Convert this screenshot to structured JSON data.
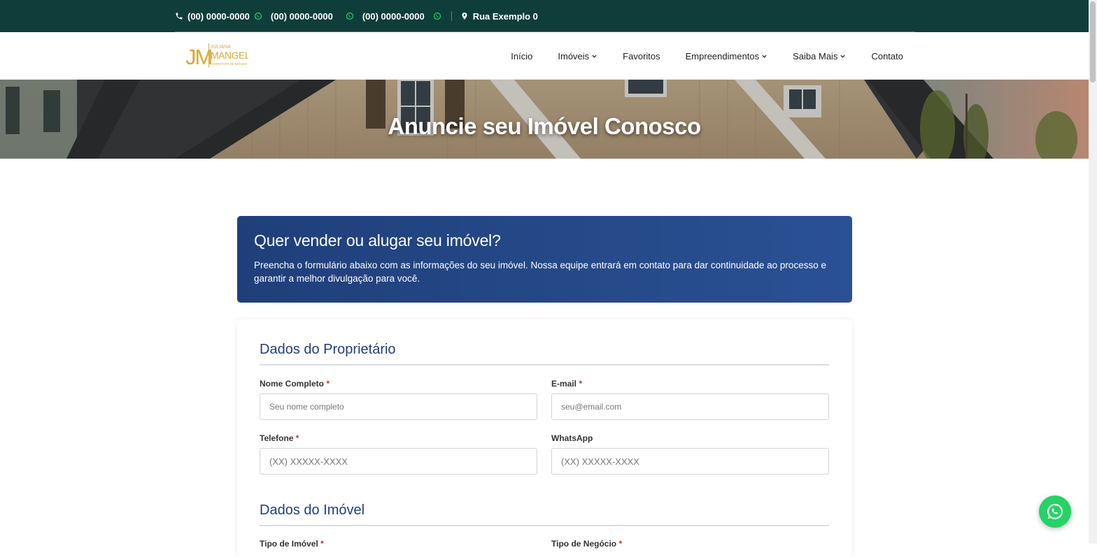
{
  "topbar": {
    "phones": [
      "(00) 0000-0000",
      "(00) 0000-0000",
      "(00) 0000-0000"
    ],
    "address": "Rua Exemplo 0"
  },
  "logo": {
    "initials": "JM",
    "first_name": "JULIANA",
    "last_name": "MANGELLI",
    "tagline": "CORRETORA DE IMÓVEIS"
  },
  "nav": {
    "items": [
      {
        "label": "Início"
      },
      {
        "label": "Imóveis"
      },
      {
        "label": "Favoritos"
      },
      {
        "label": "Empreendimentos"
      },
      {
        "label": "Saiba Mais"
      },
      {
        "label": "Contato"
      }
    ]
  },
  "hero": {
    "title": "Anuncie seu Imóvel Conosco"
  },
  "banner": {
    "title": "Quer vender ou alugar seu imóvel?",
    "text": "Preencha o formulário abaixo com as informações do seu imóvel. Nossa equipe entrará em contato para dar continuidade ao processo e garantir a melhor divulgação para você."
  },
  "form": {
    "owner_section_title": "Dados do Proprietário",
    "property_section_title": "Dados do Imóvel",
    "required_mark": "*",
    "fields": {
      "name": {
        "label": "Nome Completo",
        "placeholder": "Seu nome completo"
      },
      "email": {
        "label": "E-mail",
        "placeholder": "seu@email.com"
      },
      "phone": {
        "label": "Telefone",
        "placeholder": "(XX) XXXXX-XXXX"
      },
      "whatsapp": {
        "label": "WhatsApp",
        "placeholder": "(XX) XXXXX-XXXX"
      },
      "property_type": {
        "label": "Tipo de Imóvel"
      },
      "business_type": {
        "label": "Tipo de Negócio"
      }
    }
  },
  "colors": {
    "topbar": "#0f3d3a",
    "logo_gold": "#d9a93a",
    "banner_start": "#1f3f7a",
    "banner_end": "#2a5194",
    "whatsapp": "#25d366",
    "required": "#d0302f"
  },
  "icons": {
    "phone": "phone-icon",
    "whatsapp": "whatsapp-icon",
    "location": "map-pin-icon",
    "dropdown": "chevron-down-icon"
  }
}
